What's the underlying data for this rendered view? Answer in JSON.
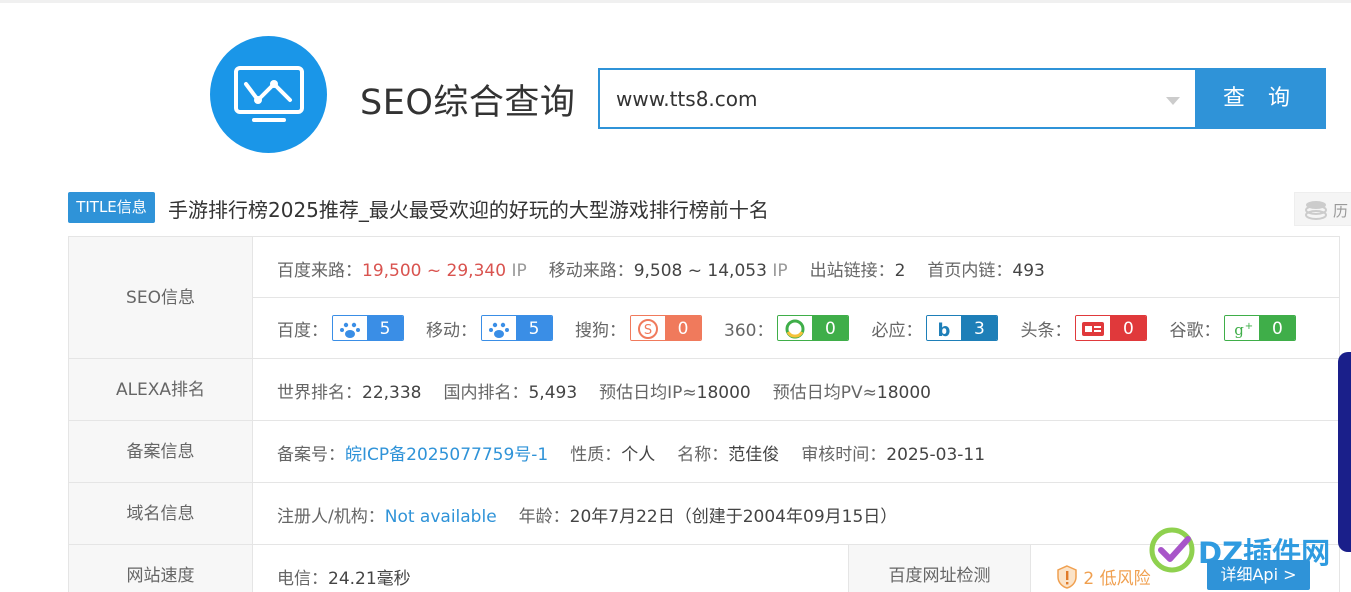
{
  "site": {
    "title": "SEO综合查询"
  },
  "search": {
    "value": "www.tts8.com",
    "button_label": "查 询"
  },
  "title_info": {
    "badge": "TITLE信息",
    "text": "手游排行榜2025推荐_最火最受欢迎的好玩的大型游戏排行榜前十名",
    "history_label": "历"
  },
  "seo": {
    "label": "SEO信息",
    "baidu_traffic_label": "百度来路：",
    "baidu_traffic_value": "19,500 ~ 29,340",
    "ip_unit": "IP",
    "mobile_traffic_label": "移动来路：",
    "mobile_traffic_value": "9,508 ~ 14,053",
    "outlinks_label": "出站链接：",
    "outlinks_value": "2",
    "inlinks_label": "首页内链：",
    "inlinks_value": "493",
    "engines": [
      {
        "label": "百度：",
        "value": "5",
        "icon": "baidu-paw-icon",
        "color": "#3a8ee6"
      },
      {
        "label": "移动：",
        "value": "5",
        "icon": "baidu-mobile-paw-icon",
        "color": "#3a8ee6"
      },
      {
        "label": "搜狗：",
        "value": "0",
        "icon": "sogou-icon",
        "color": "#f07a5c"
      },
      {
        "label": "360：",
        "value": "0",
        "icon": "360-icon",
        "color": "#3fae49"
      },
      {
        "label": "必应：",
        "value": "3",
        "icon": "bing-icon",
        "color": "#1e7fb8"
      },
      {
        "label": "头条：",
        "value": "0",
        "icon": "toutiao-icon",
        "color": "#e0393b"
      },
      {
        "label": "谷歌：",
        "value": "0",
        "icon": "google-plus-icon",
        "color": "#3fae49"
      }
    ]
  },
  "alexa": {
    "label": "ALEXA排名",
    "world_label": "世界排名：",
    "world_value": "22,338",
    "domestic_label": "国内排名：",
    "domestic_value": "5,493",
    "ip_label": "预估日均IP≈",
    "ip_value": "18000",
    "pv_label": "预估日均PV≈",
    "pv_value": "18000"
  },
  "icp": {
    "label": "备案信息",
    "number_label": "备案号：",
    "number_value": "皖ICP备2025077759号-1",
    "nature_label": "性质：",
    "nature_value": "个人",
    "name_label": "名称：",
    "name_value": "范佳俊",
    "audit_label": "审核时间：",
    "audit_value": "2025-03-11"
  },
  "domain": {
    "label": "域名信息",
    "registrant_label": "注册人/机构：",
    "registrant_value": "Not available",
    "age_label": "年龄：",
    "age_value": "20年7月22日（创建于2004年09月15日）"
  },
  "speed": {
    "label": "网站速度",
    "telecom_label": "电信：",
    "telecom_value": "24.21毫秒",
    "baidu_check_label": "百度网址检测",
    "risk_value": "2 低风险",
    "api_label": "详细Api >"
  },
  "watermark": {
    "text": "DZ插件网"
  },
  "colors": {
    "accent": "#2f93d8",
    "red": "#d9534f",
    "risk": "#f0a050"
  }
}
